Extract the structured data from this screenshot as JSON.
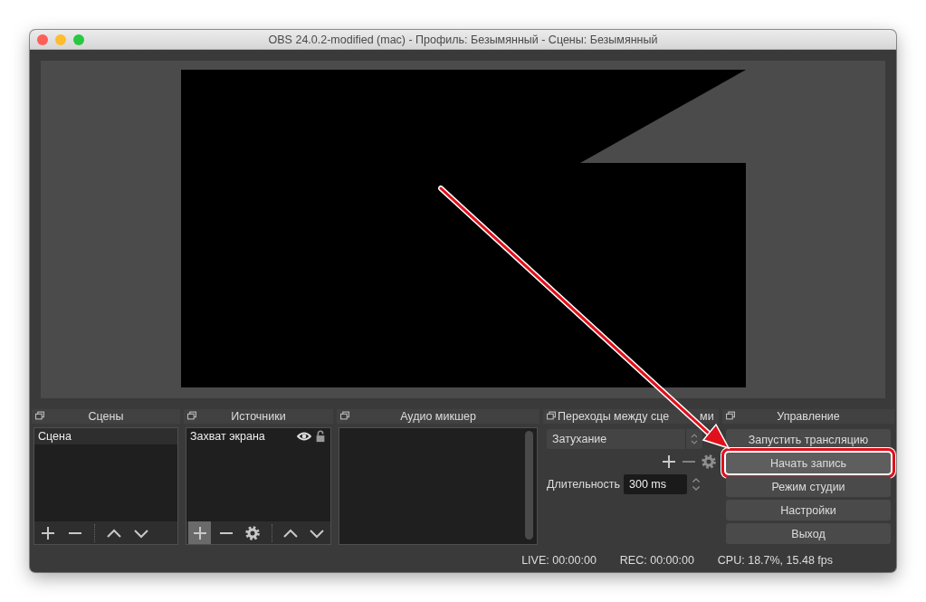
{
  "window": {
    "title": "OBS 24.0.2-modified (mac) - Профиль: Безымянный - Сцены: Безымянный"
  },
  "docks": [
    {
      "kind": "scenes",
      "title": "Сцены",
      "items": [
        {
          "label": "Сцена",
          "selected": true
        }
      ],
      "toolbar": [
        {
          "kind": "add",
          "pressed": false
        },
        {
          "kind": "remove",
          "pressed": false
        },
        {
          "kind": "up",
          "pressed": false
        },
        {
          "kind": "down",
          "pressed": false
        }
      ]
    },
    {
      "kind": "sources",
      "title": "Источники",
      "items": [
        {
          "label": "Захват экрана",
          "selected": false,
          "visible": true,
          "locked": false
        }
      ],
      "toolbar": [
        {
          "kind": "add",
          "pressed": true
        },
        {
          "kind": "remove",
          "pressed": false
        },
        {
          "kind": "gear",
          "pressed": false
        },
        {
          "kind": "up",
          "pressed": false
        },
        {
          "kind": "down",
          "pressed": false
        }
      ]
    },
    {
      "kind": "mixer",
      "title": "Аудио микшер"
    },
    {
      "kind": "transitions",
      "title": "Переходы между сце",
      "title_end": "ми",
      "transition": "Затухание",
      "duration_label": "Длительность",
      "duration": "300 ms"
    },
    {
      "kind": "controls",
      "title": "Управление",
      "buttons": [
        {
          "label": "Запустить трансляцию",
          "annotated": false
        },
        {
          "label": "Начать запись",
          "annotated": true
        },
        {
          "label": "Режим студии",
          "annotated": false
        },
        {
          "label": "Настройки",
          "annotated": false
        },
        {
          "label": "Выход",
          "annotated": false
        }
      ]
    }
  ],
  "status_bar": [
    "LIVE: 00:00:00",
    "REC: 00:00:00",
    "CPU: 18.7%, 15.48 fps"
  ]
}
